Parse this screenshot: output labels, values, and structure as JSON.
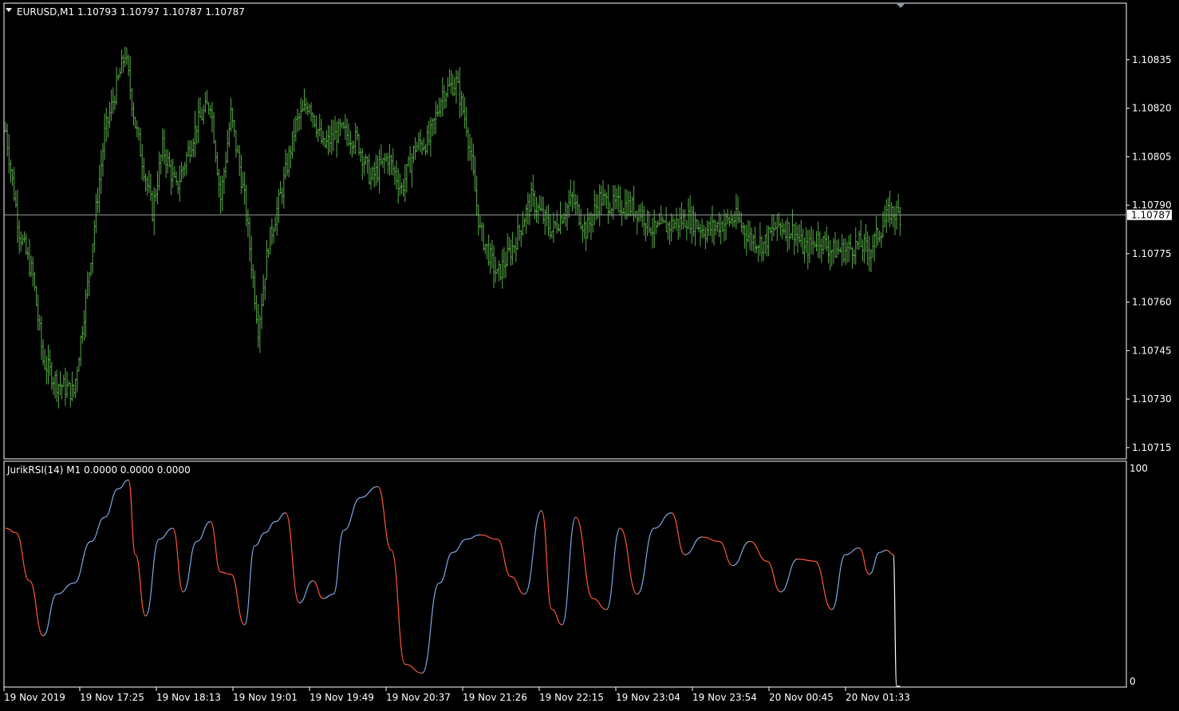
{
  "main_pane": {
    "symbol_label": "EURUSD,M1",
    "ohlc_label": "1.10793 1.10797 1.10787 1.10787",
    "current_price_label": "1.10787"
  },
  "indicator_pane": {
    "label": "JurikRSI(14) M1 0.0000 0.0000 0.0000",
    "scale_top_label": "100",
    "scale_bottom_label": "0"
  },
  "colors": {
    "background": "#000000",
    "pane_border": "#ffffff",
    "candle": "#55aa44",
    "price_line": "#9aa5a0",
    "rsi_up": "#7aa8e6",
    "rsi_down": "#ff5533",
    "text": "#ffffff"
  },
  "chart_data": [
    {
      "type": "bar",
      "subtype": "ohlc",
      "symbol": "EURUSD",
      "timeframe": "M1",
      "ylim": [
        1.10712,
        1.10852
      ],
      "yticks": [
        1.10835,
        1.1082,
        1.10805,
        1.1079,
        1.10775,
        1.1076,
        1.10745,
        1.1073,
        1.10715
      ],
      "ytick_labels": [
        "1.10835",
        "1.10820",
        "1.10805",
        "1.10790",
        "1.10775",
        "1.10760",
        "1.10745",
        "1.10730",
        "1.10715"
      ],
      "current_price": 1.10787,
      "x_labels": [
        "19 Nov 2019",
        "19 Nov 17:25",
        "19 Nov 18:13",
        "19 Nov 19:01",
        "19 Nov 19:49",
        "19 Nov 20:37",
        "19 Nov 21:26",
        "19 Nov 22:15",
        "19 Nov 23:04",
        "19 Nov 23:54",
        "20 Nov 00:45",
        "20 Nov 01:33"
      ],
      "grid": false,
      "close_path": [
        [
          0,
          1.10813
        ],
        [
          8,
          1.10782
        ],
        [
          16,
          1.10768
        ],
        [
          22,
          1.10742
        ],
        [
          30,
          1.10735
        ],
        [
          40,
          1.10732
        ],
        [
          48,
          1.10765
        ],
        [
          58,
          1.10812
        ],
        [
          70,
          1.10837
        ],
        [
          76,
          1.10815
        ],
        [
          86,
          1.10788
        ],
        [
          92,
          1.10808
        ],
        [
          100,
          1.10795
        ],
        [
          112,
          1.10815
        ],
        [
          120,
          1.10822
        ],
        [
          126,
          1.10792
        ],
        [
          132,
          1.10818
        ],
        [
          140,
          1.10792
        ],
        [
          148,
          1.10752
        ],
        [
          154,
          1.10778
        ],
        [
          162,
          1.10795
        ],
        [
          170,
          1.10815
        ],
        [
          178,
          1.10822
        ],
        [
          186,
          1.10808
        ],
        [
          196,
          1.10813
        ],
        [
          206,
          1.1081
        ],
        [
          214,
          1.10798
        ],
        [
          224,
          1.10805
        ],
        [
          232,
          1.10795
        ],
        [
          240,
          1.10808
        ],
        [
          248,
          1.1081
        ],
        [
          256,
          1.10825
        ],
        [
          264,
          1.10828
        ],
        [
          270,
          1.10815
        ],
        [
          278,
          1.10782
        ],
        [
          288,
          1.10768
        ],
        [
          298,
          1.10778
        ],
        [
          308,
          1.10792
        ],
        [
          320,
          1.10782
        ],
        [
          332,
          1.10792
        ],
        [
          340,
          1.10782
        ],
        [
          348,
          1.10792
        ],
        [
          356,
          1.1079
        ],
        [
          364,
          1.1079
        ],
        [
          372,
          1.10788
        ],
        [
          380,
          1.10782
        ],
        [
          390,
          1.10784
        ],
        [
          400,
          1.10786
        ],
        [
          410,
          1.10782
        ],
        [
          418,
          1.10784
        ],
        [
          428,
          1.10786
        ],
        [
          436,
          1.1078
        ],
        [
          444,
          1.10778
        ],
        [
          452,
          1.10784
        ],
        [
          462,
          1.10782
        ],
        [
          468,
          1.10776
        ],
        [
          476,
          1.1078
        ],
        [
          484,
          1.10776
        ],
        [
          492,
          1.10776
        ],
        [
          500,
          1.10778
        ],
        [
          506,
          1.10776
        ],
        [
          512,
          1.10782
        ],
        [
          518,
          1.10788
        ],
        [
          524,
          1.10787
        ]
      ]
    },
    {
      "type": "line",
      "name": "JurikRSI(14)",
      "ylim": [
        0,
        100
      ],
      "yticks": [
        100,
        0
      ],
      "x": [
        0,
        6,
        14,
        22,
        30,
        40,
        50,
        58,
        66,
        72,
        76,
        82,
        90,
        98,
        104,
        112,
        120,
        126,
        132,
        140,
        146,
        152,
        158,
        164,
        172,
        180,
        186,
        192,
        198,
        208,
        218,
        226,
        234,
        244,
        254,
        262,
        270,
        278,
        288,
        296,
        304,
        314,
        320,
        326,
        334,
        344,
        352,
        360,
        370,
        380,
        390,
        398,
        408,
        418,
        426,
        436,
        446,
        454,
        464,
        474,
        484,
        492,
        500,
        506,
        512,
        516,
        520,
        522,
        524
      ],
      "values": [
        72,
        70,
        48,
        23,
        42,
        47,
        66,
        77,
        90,
        94,
        60,
        32,
        67,
        72,
        43,
        66,
        75,
        52,
        51,
        28,
        64,
        70,
        75,
        79,
        38,
        48,
        40,
        42,
        71,
        86,
        91,
        62,
        10,
        6,
        47,
        61,
        67,
        69,
        67,
        50,
        42,
        80,
        35,
        28,
        77,
        40,
        35,
        72,
        42,
        72,
        79,
        60,
        68,
        66,
        55,
        66,
        57,
        43,
        58,
        57,
        35,
        60,
        63,
        51,
        61,
        62,
        60,
        0,
        0
      ]
    }
  ]
}
